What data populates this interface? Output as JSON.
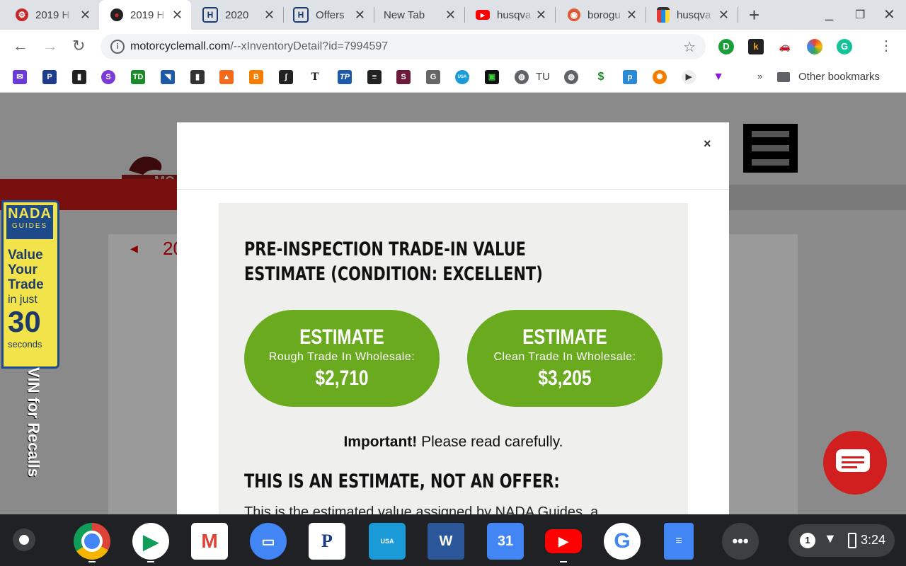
{
  "browser": {
    "tabs": [
      {
        "title": "2019 H",
        "favicon": "motorcycle-icon",
        "color": "#c62828"
      },
      {
        "title": "2019 H",
        "favicon": "rider-icon",
        "color": "#c62828",
        "active": true
      },
      {
        "title": "2020",
        "favicon": "husqvarna-icon",
        "color": "#1e3a6a"
      },
      {
        "title": "Offers",
        "favicon": "husqvarna-icon",
        "color": "#1e3a6a"
      },
      {
        "title": "New Tab",
        "favicon": "",
        "color": "#ffffff"
      },
      {
        "title": "husqva",
        "favicon": "youtube-icon",
        "color": "#ff0000"
      },
      {
        "title": "borogu",
        "favicon": "duckduckgo-icon",
        "color": "#de5833"
      },
      {
        "title": "husqva",
        "favicon": "shopping-bag-icon",
        "color": "#333333"
      }
    ],
    "address": {
      "host": "motorcyclemall.com",
      "path": "/--xInventoryDetail?id=7994597"
    },
    "bookmarks": {
      "tu_label": "TU",
      "other_label": "Other bookmarks"
    }
  },
  "page": {
    "year_fragment": "20",
    "logo_fragment": "MO"
  },
  "nada": {
    "logo_line1": "NADA",
    "logo_line2": "GUIDES",
    "value": "Value",
    "your": "Your",
    "trade": "Trade",
    "in_just": "in just",
    "thirty": "30",
    "seconds": "seconds",
    "vin": "VIN for Recalls"
  },
  "modal": {
    "close": "×",
    "title": "PRE-INSPECTION TRADE-IN VALUE ESTIMATE (CONDITION: EXCELLENT)",
    "estimates": [
      {
        "heading": "ESTIMATE",
        "label": "Rough Trade In Wholesale:",
        "value": "$2,710"
      },
      {
        "heading": "ESTIMATE",
        "label": "Clean Trade In Wholesale:",
        "value": "$3,205"
      }
    ],
    "important_bold": "Important!",
    "important_rest": " Please read carefully.",
    "subhead": "THIS IS AN ESTIMATE, NOT AN OFFER:",
    "truncated_line": "This is the estimated value assigned by NADA Guides, a"
  },
  "shelf": {
    "notification_count": "1",
    "time": "3:24"
  },
  "colors": {
    "estimate_green": "#6aaa1e",
    "chat_red": "#d11f1f",
    "nada_yellow": "#f2e34a",
    "nada_blue": "#1e4a8a"
  }
}
